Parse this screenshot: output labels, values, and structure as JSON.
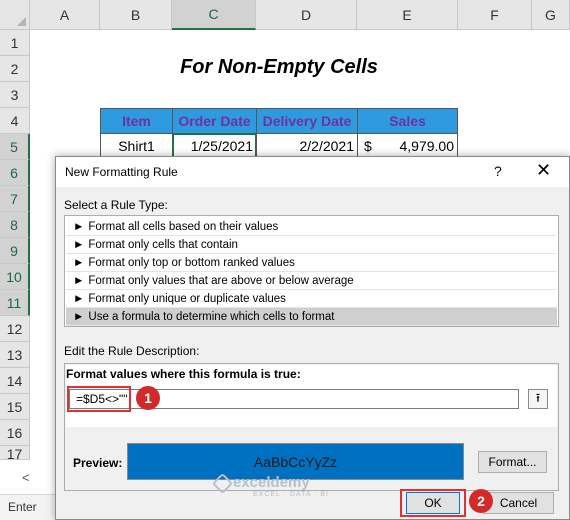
{
  "sheet": {
    "columns": [
      "A",
      "B",
      "C",
      "D",
      "E",
      "F",
      "G"
    ],
    "selected_column": "C",
    "rows": [
      "1",
      "2",
      "3",
      "4",
      "5",
      "6",
      "7",
      "8",
      "9",
      "10",
      "11",
      "12",
      "13",
      "14",
      "15",
      "16",
      "17"
    ],
    "title": "For Non-Empty Cells",
    "table": {
      "headers": [
        "Item",
        "Order Date",
        "Delivery Date",
        "Sales"
      ],
      "rows": [
        {
          "item": "Shirt1",
          "order_date": "1/25/2021",
          "delivery_date": "2/2/2021",
          "currency": "$",
          "sales": "4,979.00"
        }
      ]
    },
    "header_color": "#2e9be0",
    "header_text_color": "#7030a0",
    "status_mode": "Enter",
    "scroll_left_arrow": "<"
  },
  "dialog": {
    "title": "New Formatting Rule",
    "help_label": "?",
    "close_label": "✕",
    "select_rule_type_label": "Select a Rule Type:",
    "rule_types": [
      "Format all cells based on their values",
      "Format only cells that contain",
      "Format only top or bottom ranked values",
      "Format only values that are above or below average",
      "Format only unique or duplicate values",
      "Use a formula to determine which cells to format"
    ],
    "selected_rule_index": 5,
    "rule_arrow": "►",
    "edit_description_label": "Edit the Rule Description:",
    "formula_label": "Format values where this formula is true:",
    "formula_value": "=$D5<>\"\"",
    "collapse_icon": "up-arrow-icon",
    "collapse_glyph": "⭱",
    "preview_label": "Preview:",
    "preview_text": "AaBbCcYyZz",
    "preview_fill": "#0070c0",
    "format_button": "Format...",
    "ok_button": "OK",
    "cancel_button": "Cancel"
  },
  "annotations": {
    "badge_1": "1",
    "badge_2": "2",
    "highlight_color": "#e03030"
  },
  "watermark": {
    "brand": "exceldemy",
    "tagline": "EXCEL · DATA · BI"
  }
}
